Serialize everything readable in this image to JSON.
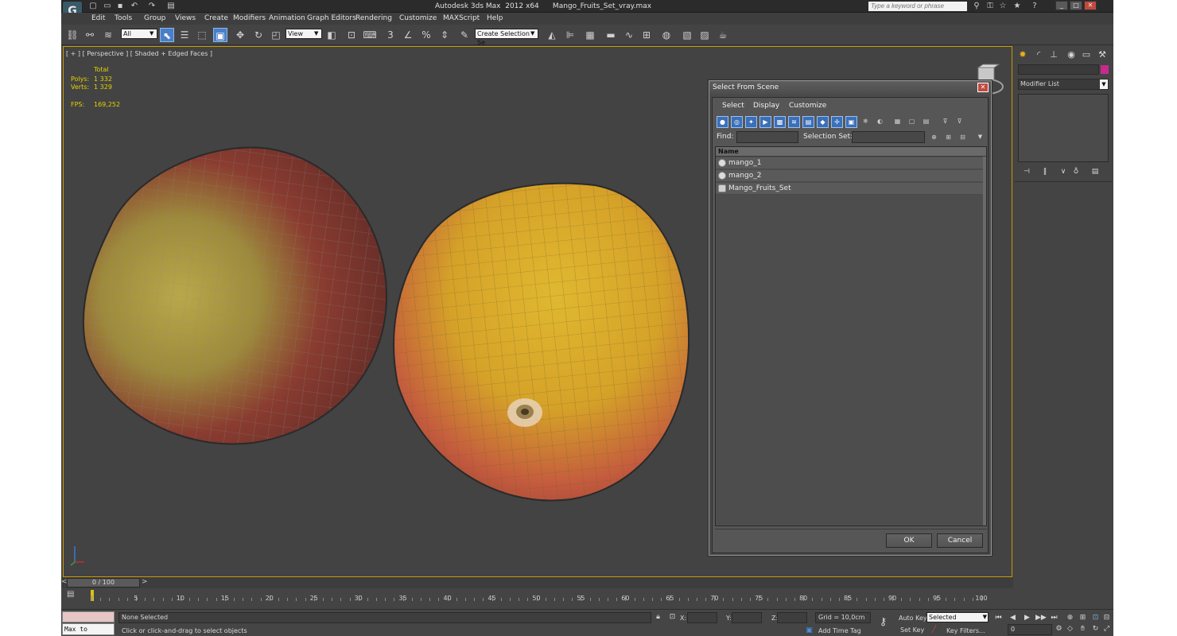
{
  "titlebar": {
    "title": "Autodesk 3ds Max  2012 x64      Mango_Fruits_Set_vray.max",
    "logo": "G",
    "search_placeholder": "Type a keyword or phrase",
    "quick_access_icons": [
      "new-file-icon",
      "open-file-icon",
      "save-icon",
      "undo-icon",
      "redo-icon",
      "project-folder-icon"
    ]
  },
  "menubar": {
    "items": [
      "Edit",
      "Tools",
      "Group",
      "Views",
      "Create",
      "Modifiers",
      "Animation",
      "Graph Editors",
      "Rendering",
      "Customize",
      "MAXScript",
      "Help"
    ]
  },
  "toolbar": {
    "selection_filter": "All",
    "ref_coord": "View",
    "named_selection": "Create Selection Se",
    "snap_labels": [
      "3",
      "%"
    ]
  },
  "viewport": {
    "label": "[ + ] [ Perspective ] [ Shaded + Edged Faces ]",
    "stats": {
      "total_label": "Total",
      "polys_label": "Polys:",
      "polys_value": "1 332",
      "verts_label": "Verts:",
      "verts_value": "1 329",
      "fps_label": "FPS:",
      "fps_value": "169,252"
    }
  },
  "dialog": {
    "title": "Select From Scene",
    "menu": [
      "Select",
      "Display",
      "Customize"
    ],
    "find_label": "Find:",
    "selection_set_label": "Selection Set:",
    "column_name": "Name",
    "items": [
      "mango_1",
      "mango_2",
      "Mango_Fruits_Set"
    ],
    "ok_label": "OK",
    "cancel_label": "Cancel"
  },
  "command_panel": {
    "modifier_list": "Modifier List",
    "object_color": "#c62b8c"
  },
  "timeline": {
    "slider": "0 / 100",
    "ticks": [
      "5",
      "10",
      "15",
      "20",
      "25",
      "30",
      "35",
      "40",
      "45",
      "50",
      "55",
      "60",
      "65",
      "70",
      "75",
      "80",
      "85",
      "90",
      "95",
      "100"
    ]
  },
  "status": {
    "maxscript_label": "Max to Physc.",
    "selection": "None Selected",
    "prompt": "Click or click-and-drag to select objects",
    "x_label": "X:",
    "y_label": "Y:",
    "z_label": "Z:",
    "grid": "Grid = 10,0cm",
    "auto_key": "Auto Key",
    "set_key": "Set Key",
    "key_mode": "Selected",
    "key_filters": "Key Filters...",
    "add_time_tag": "Add Time Tag",
    "frame": "0"
  }
}
